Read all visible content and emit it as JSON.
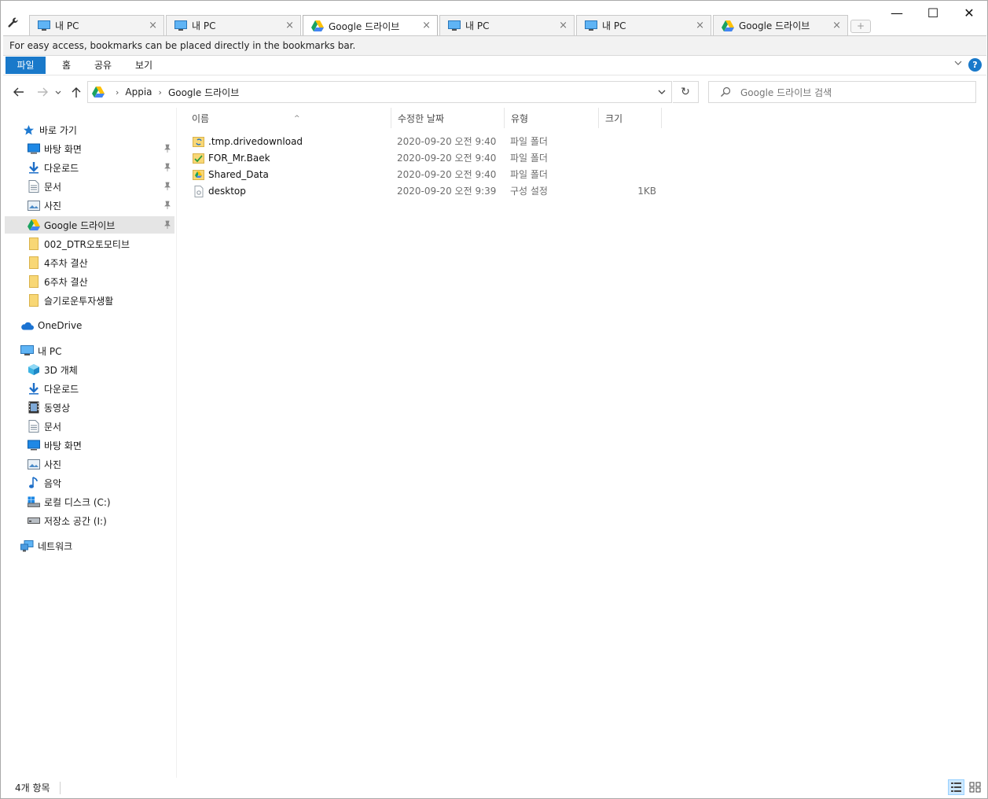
{
  "tabs": [
    {
      "title": "내 PC",
      "icon": "pc-icon",
      "active": false
    },
    {
      "title": "내 PC",
      "icon": "pc-icon",
      "active": false
    },
    {
      "title": "Google 드라이브",
      "icon": "google-drive-icon",
      "active": true
    },
    {
      "title": "내 PC",
      "icon": "pc-icon",
      "active": false
    },
    {
      "title": "내 PC",
      "icon": "pc-icon",
      "active": false
    },
    {
      "title": "Google 드라이브",
      "icon": "google-drive-icon",
      "active": false
    }
  ],
  "tab_close_glyph": "×",
  "new_tab_glyph": "+",
  "window_controls": {
    "minimize": "—",
    "maximize": "☐",
    "close": "✕"
  },
  "bookmark_hint": "For easy access, bookmarks can be placed directly in the bookmarks bar.",
  "ribbon": {
    "file": "파일",
    "home": "홈",
    "share": "공유",
    "view": "보기",
    "help": "?"
  },
  "address": {
    "crumbs": [
      "Appia",
      "Google 드라이브"
    ],
    "refresh_glyph": "↻"
  },
  "search": {
    "placeholder": "Google 드라이브 검색"
  },
  "nav": {
    "quick_access": "바로 가기",
    "quick_items": [
      {
        "label": "바탕 화면",
        "icon": "desktop-icon",
        "pinned": true
      },
      {
        "label": "다운로드",
        "icon": "download-icon",
        "pinned": true
      },
      {
        "label": "문서",
        "icon": "document-icon",
        "pinned": true
      },
      {
        "label": "사진",
        "icon": "pictures-icon",
        "pinned": true
      },
      {
        "label": "Google 드라이브",
        "icon": "google-drive-icon",
        "pinned": true,
        "selected": true
      },
      {
        "label": "002_DTR오토모티브",
        "icon": "folder-icon",
        "pinned": false
      },
      {
        "label": "4주차 결산",
        "icon": "folder-icon",
        "pinned": false
      },
      {
        "label": "6주차 결산",
        "icon": "folder-icon",
        "pinned": false
      },
      {
        "label": "슬기로운투자생활",
        "icon": "folder-icon",
        "pinned": false
      }
    ],
    "onedrive": "OneDrive",
    "this_pc": "내 PC",
    "pc_items": [
      {
        "label": "3D 개체",
        "icon": "3d-objects-icon"
      },
      {
        "label": "다운로드",
        "icon": "download-icon"
      },
      {
        "label": "동영상",
        "icon": "video-icon"
      },
      {
        "label": "문서",
        "icon": "document-icon"
      },
      {
        "label": "바탕 화면",
        "icon": "desktop-icon"
      },
      {
        "label": "사진",
        "icon": "pictures-icon"
      },
      {
        "label": "음악",
        "icon": "music-icon"
      },
      {
        "label": "로컬 디스크 (C:)",
        "icon": "local-disk-icon"
      },
      {
        "label": "저장소 공간 (I:)",
        "icon": "storage-drive-icon"
      }
    ],
    "network": "네트워크"
  },
  "columns": {
    "name": "이름",
    "date": "수정한 날짜",
    "type": "유형",
    "size": "크기",
    "sort_glyph": "^"
  },
  "files": [
    {
      "name": ".tmp.drivedownload",
      "date": "2020-09-20 오전 9:40",
      "type": "파일 폴더",
      "size": "",
      "icon": "sync-folder-icon"
    },
    {
      "name": "FOR_Mr.Baek",
      "date": "2020-09-20 오전 9:40",
      "type": "파일 폴더",
      "size": "",
      "icon": "synced-folder-icon"
    },
    {
      "name": "Shared_Data",
      "date": "2020-09-20 오전 9:40",
      "type": "파일 폴더",
      "size": "",
      "icon": "shared-drive-folder-icon"
    },
    {
      "name": "desktop",
      "date": "2020-09-20 오전 9:39",
      "type": "구성 설정",
      "size": "1KB",
      "icon": "settings-file-icon"
    }
  ],
  "status": {
    "item_count": "4개 항목"
  },
  "colors": {
    "accent": "#1979ca",
    "folder": "#f8d775",
    "selected_bg": "#e5e5e5"
  }
}
